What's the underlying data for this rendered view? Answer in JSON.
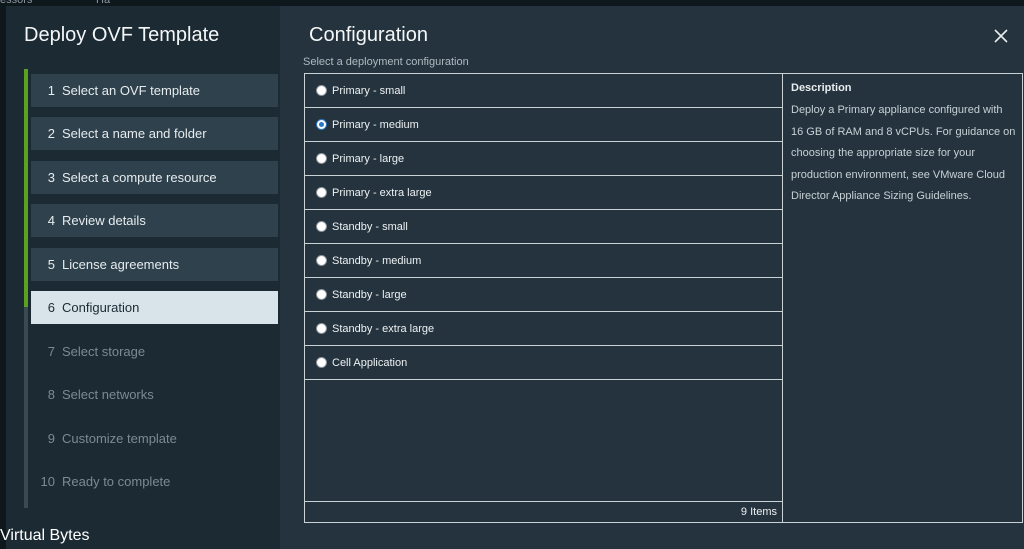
{
  "background": {
    "top_text_1": "essors",
    "top_text_2": "Ha"
  },
  "wizard": {
    "title": "Deploy OVF Template",
    "steps": [
      {
        "num": "1",
        "label": "Select an OVF template",
        "state": "done"
      },
      {
        "num": "2",
        "label": "Select a name and folder",
        "state": "done"
      },
      {
        "num": "3",
        "label": "Select a compute resource",
        "state": "done"
      },
      {
        "num": "4",
        "label": "Review details",
        "state": "done"
      },
      {
        "num": "5",
        "label": "License agreements",
        "state": "done"
      },
      {
        "num": "6",
        "label": "Configuration",
        "state": "active"
      },
      {
        "num": "7",
        "label": "Select storage",
        "state": "future"
      },
      {
        "num": "8",
        "label": "Select networks",
        "state": "future"
      },
      {
        "num": "9",
        "label": "Customize template",
        "state": "future"
      },
      {
        "num": "10",
        "label": "Ready to complete",
        "state": "future"
      }
    ]
  },
  "main": {
    "title": "Configuration",
    "subtitle": "Select a deployment configuration",
    "options": [
      {
        "label": "Primary - small",
        "selected": false
      },
      {
        "label": "Primary - medium",
        "selected": true
      },
      {
        "label": "Primary - large",
        "selected": false
      },
      {
        "label": "Primary - extra large",
        "selected": false
      },
      {
        "label": "Standby - small",
        "selected": false
      },
      {
        "label": "Standby - medium",
        "selected": false
      },
      {
        "label": "Standby - large",
        "selected": false
      },
      {
        "label": "Standby - extra large",
        "selected": false
      },
      {
        "label": "Cell Application",
        "selected": false
      }
    ],
    "item_count": "9 Items",
    "description_heading": "Description",
    "description_text": "Deploy a Primary appliance configured with 16 GB of RAM and 8 vCPUs. For guidance on choosing the appropriate size for your production environment, see VMware Cloud Director Appliance Sizing Guidelines."
  },
  "close_icon": "close-icon",
  "watermark": "Virtual Bytes",
  "colors": {
    "accent_green": "#5aa220",
    "radio_blue": "#2a78c5",
    "active_step": "#d9e4ea"
  }
}
